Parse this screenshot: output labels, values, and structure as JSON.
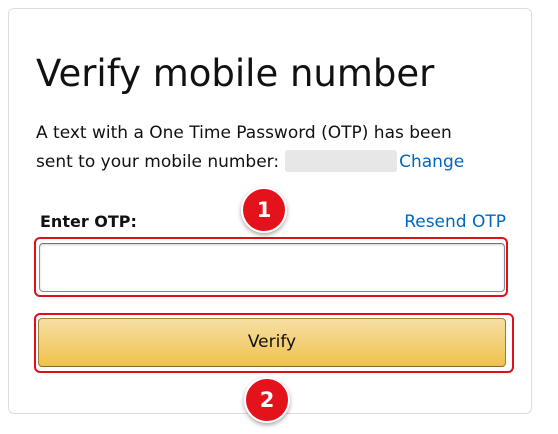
{
  "page": {
    "title": "Verify mobile number",
    "description_line1": "A text with a One Time Password (OTP) has been",
    "description_line2": "sent to your mobile number:",
    "change_link": "Change"
  },
  "form": {
    "otp_label": "Enter OTP:",
    "resend_link": "Resend OTP",
    "otp_value": "",
    "verify_label": "Verify"
  },
  "annotations": {
    "badge_1": "1",
    "badge_2": "2",
    "highlight_color": "#e0101a"
  },
  "colors": {
    "link": "#0066c0",
    "button_top": "#f7dfa5",
    "button_bottom": "#f0c14b",
    "badge": "#e3121b"
  }
}
